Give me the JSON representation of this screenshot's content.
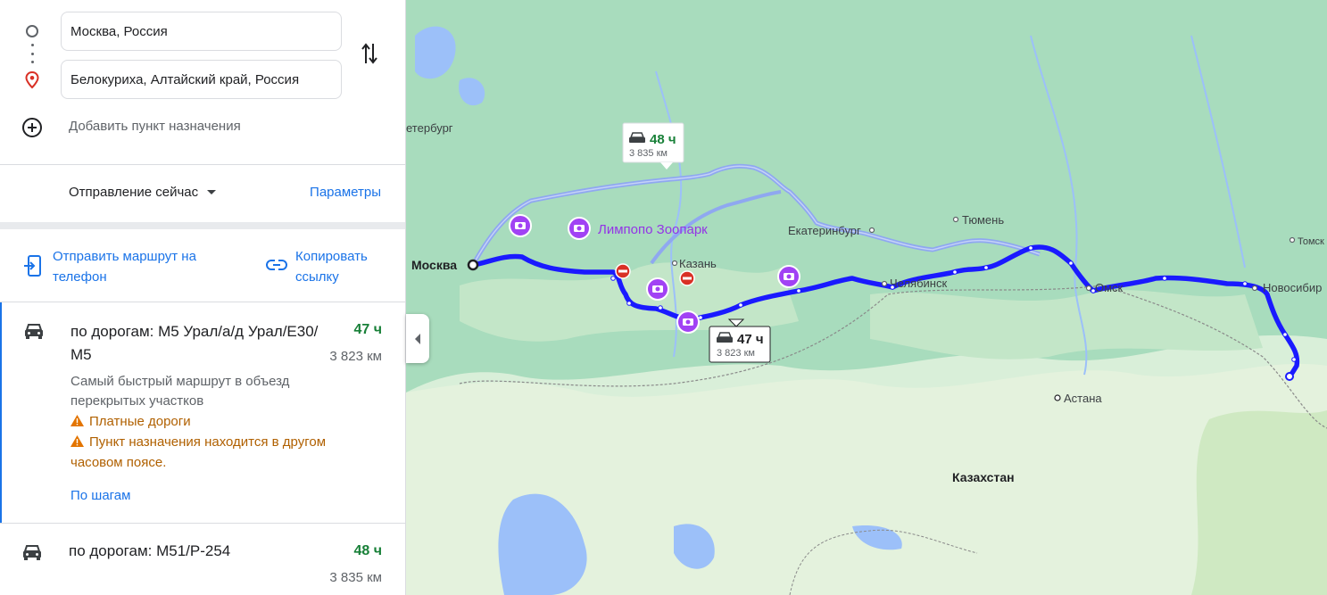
{
  "directions": {
    "origin": "Москва, Россия",
    "destination": "Белокуриха, Алтайский край, Россия",
    "add_destination": "Добавить пункт назначения",
    "depart": "Отправление сейчас",
    "options": "Параметры",
    "send_to_phone": "Отправить маршрут на телефон",
    "copy_link": "Копировать ссылку"
  },
  "routes": [
    {
      "title": "по дорогам: М5 Урал/а/д Урал/Е30/М5",
      "time": "47 ч",
      "distance": "3 823 км",
      "description": "Самый быстрый маршрут в объезд перекрытых участков",
      "warnings": [
        "Платные дороги",
        "Пункт назначения находится в другом часовом поясе."
      ],
      "steps_link": "По шагам"
    },
    {
      "title": "по дорогам: М51/Р-254",
      "time": "48 ч",
      "distance": "3 835 км"
    }
  ],
  "map": {
    "callouts": [
      {
        "time": "48 ч",
        "distance": "3 835 км"
      },
      {
        "time": "47 ч",
        "distance": "3 823 км"
      }
    ],
    "labels": {
      "moscow": "Москва",
      "spb": "етербург",
      "kazan": "Казань",
      "ekb": "Екатеринбург",
      "tyumen": "Тюмень",
      "chelyabinsk": "Челябинск",
      "omsk": "Омск",
      "novosibirsk": "Новосибир",
      "tomsk": "Томск",
      "astana": "Астана",
      "kazakhstan": "Казахстан",
      "zoo": "Лимпопо Зоопарк"
    },
    "colors": {
      "land": "#d9efd9",
      "forest": "#a8dcbd",
      "water": "#9cc0f9",
      "route_main": "#1a1aff",
      "route_alt": "#8fa8f0"
    }
  }
}
